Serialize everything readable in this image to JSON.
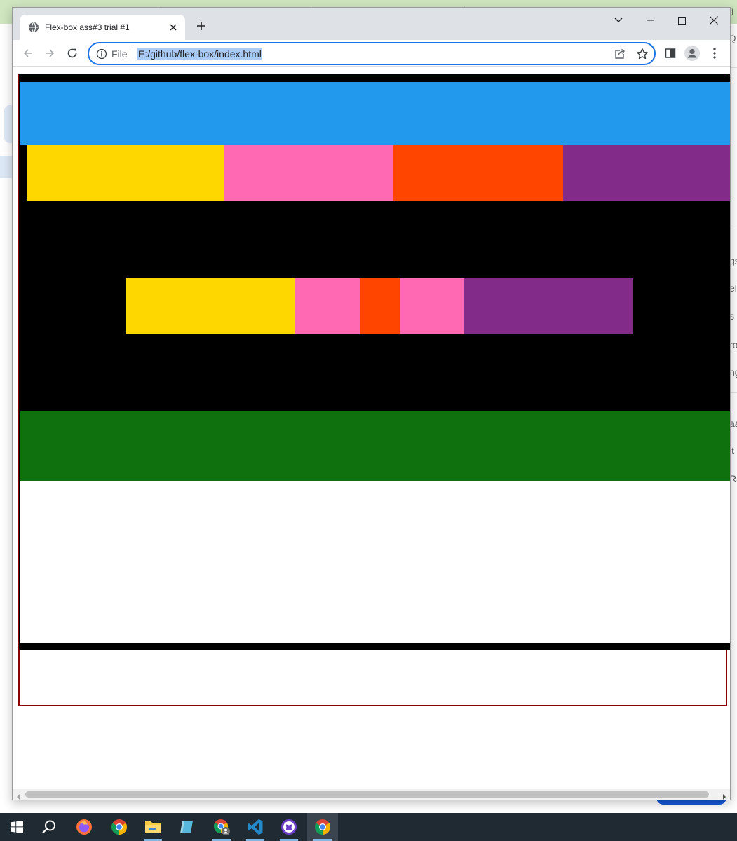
{
  "browser": {
    "tab_title": "Flex-box ass#3 trial #1",
    "omnibox_scheme": "File",
    "url": "E:/github/flex-box/index.html"
  },
  "background_window": {
    "right_edge_fragments": [
      "fl",
      "Q",
      "gs",
      "ele",
      "s I",
      "ro",
      "ng",
      "aa",
      "it",
      "Ra"
    ]
  },
  "page_colors": {
    "frame_border": "#8b0000",
    "container": "#000000",
    "header": "#2299ec",
    "gold": "#ffd700",
    "pink": "#ff69b4",
    "orange": "#ff4500",
    "purple": "#822b88",
    "footer": "#0e710d",
    "bottom_area": "#ffffff"
  },
  "taskbar": {
    "items": [
      "start-icon",
      "search-icon",
      "firefox-icon",
      "chrome-icon",
      "file-explorer-icon",
      "notepad-icon",
      "chrome-profile-icon",
      "vscode-icon",
      "github-desktop-icon",
      "chrome-active-icon"
    ]
  }
}
